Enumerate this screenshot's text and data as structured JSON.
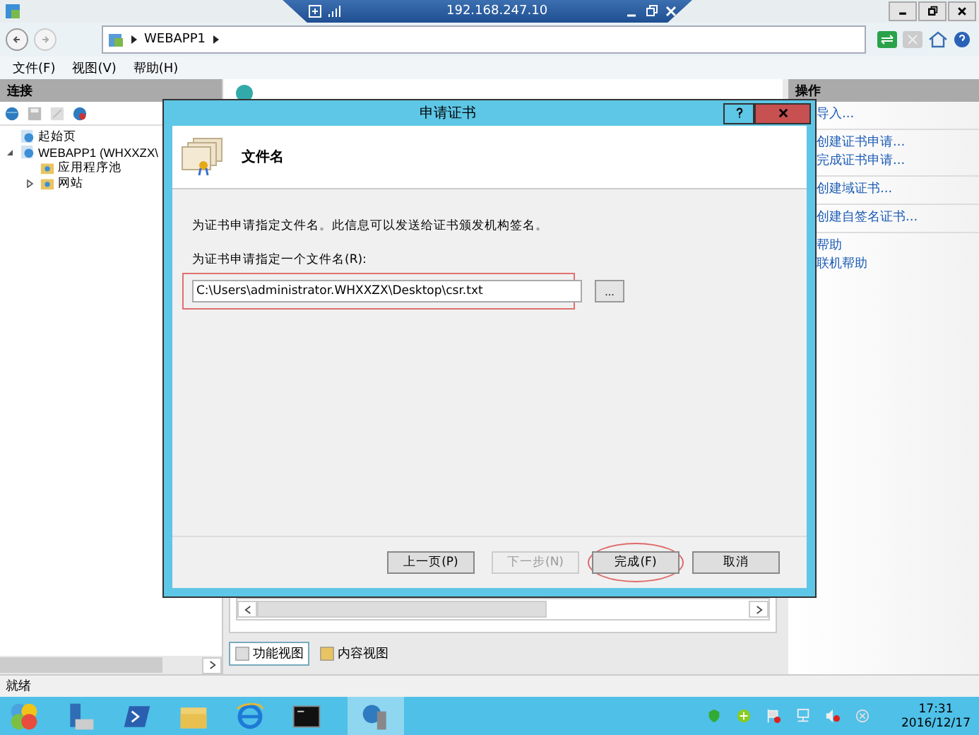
{
  "remote_bar": {
    "title": "192.168.247.10"
  },
  "address_bar": {
    "crumbs": [
      "WEBAPP1"
    ]
  },
  "menu": [
    "文件(F)",
    "视图(V)",
    "帮助(H)"
  ],
  "connections": {
    "title": "连接",
    "tree": [
      {
        "label": "起始页"
      },
      {
        "label": "WEBAPP1 (WHXXZX\\",
        "expanded": true,
        "children": [
          {
            "label": "应用程序池"
          },
          {
            "label": "网站",
            "expanded": false
          }
        ]
      }
    ]
  },
  "views": [
    {
      "label": "功能视图",
      "selected": true
    },
    {
      "label": "内容视图",
      "selected": false
    }
  ],
  "actions": {
    "title": "操作",
    "groups": [
      [
        "导入..."
      ],
      [
        "创建证书申请...",
        "完成证书申请..."
      ],
      [
        "创建域证书..."
      ],
      [
        "创建自签名证书..."
      ],
      [
        "帮助",
        "联机帮助"
      ]
    ]
  },
  "status_bar": "就绪",
  "dialog": {
    "title": "申请证书",
    "heading": "文件名",
    "description": "为证书申请指定文件名。此信息可以发送给证书颁发机构签名。",
    "field_label": "为证书申请指定一个文件名(R):",
    "file_name": "C:\\Users\\administrator.WHXXZX\\Desktop\\csr.txt",
    "browse": "...",
    "buttons": [
      {
        "label": "上一页(P)",
        "disabled": false,
        "circled": false
      },
      {
        "label": "下一步(N)",
        "disabled": true,
        "circled": false
      },
      {
        "label": "完成(F)",
        "disabled": false,
        "circled": true
      },
      {
        "label": "取消",
        "disabled": false,
        "circled": false
      }
    ]
  },
  "taskbar": {
    "time": "17:31",
    "date": "2016/12/17"
  }
}
